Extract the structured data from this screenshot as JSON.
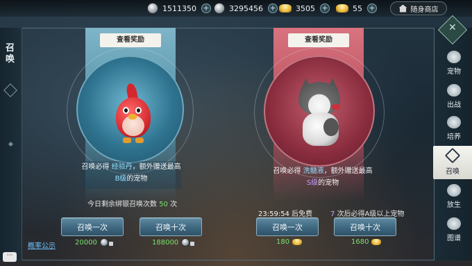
{
  "currencies": [
    {
      "name": "silver-coins",
      "value": "1511350"
    },
    {
      "name": "bound-silver",
      "value": "3295456"
    },
    {
      "name": "gold-ingot",
      "value": "3505"
    },
    {
      "name": "bound-gold",
      "value": "55"
    }
  ],
  "shop_label": "随身商店",
  "panel_title": "召唤",
  "pets": {
    "blue": {
      "reward_label": "查看奖励",
      "desc_prefix": "召唤必得",
      "desc_item": "经验丹",
      "desc_mid": "，额外赠送最高",
      "desc_grade": "B级",
      "desc_suffix": "的宠物",
      "remaining_prefix": "今日剩余绑银召唤次数",
      "remaining_count": "50",
      "remaining_suffix": "次",
      "btn_once": "召唤一次",
      "btn_ten": "召唤十次",
      "cost_once": "20000",
      "cost_ten": "188000"
    },
    "red": {
      "reward_label": "查看奖励",
      "desc_prefix": "召唤必得",
      "desc_item": "洗髓液",
      "desc_mid": "，额外赠送最高",
      "desc_grade": "S级",
      "desc_suffix": "的宠物",
      "timer": "23:59:54",
      "timer_suffix": "后免费",
      "guarantee_count": "7",
      "guarantee_suffix": "次后必得A级以上宠物",
      "btn_once": "召唤一次",
      "btn_ten": "召唤十次",
      "cost_once": "180",
      "cost_ten": "1680"
    }
  },
  "notice_label": "概率公示",
  "tabs": [
    {
      "label": "宠物",
      "icon": "paw-icon"
    },
    {
      "label": "出战",
      "icon": "paw-battle-icon"
    },
    {
      "label": "培养",
      "icon": "train-icon"
    },
    {
      "label": "召唤",
      "icon": "summon-icon",
      "active": true
    },
    {
      "label": "放生",
      "icon": "release-icon"
    },
    {
      "label": "图谱",
      "icon": "atlas-icon"
    }
  ],
  "colors": {
    "accent_blue": "#6fc3ff",
    "cost_green": "#7ee06f",
    "grade_violet": "#c59cff"
  }
}
